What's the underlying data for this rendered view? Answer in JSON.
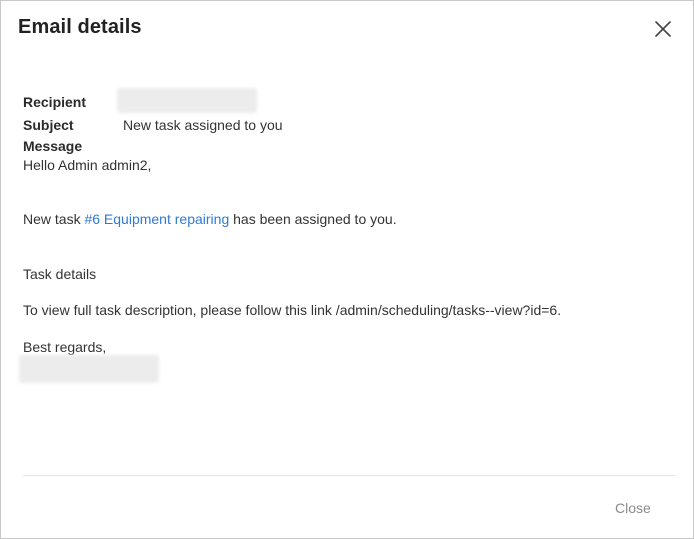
{
  "dialog": {
    "title": "Email details",
    "close_button_label": "Close"
  },
  "fields": {
    "recipient_label": "Recipient",
    "subject_label": "Subject",
    "subject_value": "New task assigned to you",
    "message_label": "Message"
  },
  "message": {
    "greeting": "Hello Admin admin2,",
    "assigned_prefix": "New task ",
    "task_link": "#6 Equipment repairing",
    "assigned_suffix": " has been assigned to you.",
    "task_details": "Task details",
    "view_instructions": "To view full task description, please follow this link /admin/scheduling/tasks--view?id=6.",
    "regards": "Best regards,"
  },
  "icons": {
    "close": "close-icon"
  },
  "colors": {
    "link": "#2f7ad6",
    "title": "#222222",
    "muted": "#8a8a8a"
  }
}
